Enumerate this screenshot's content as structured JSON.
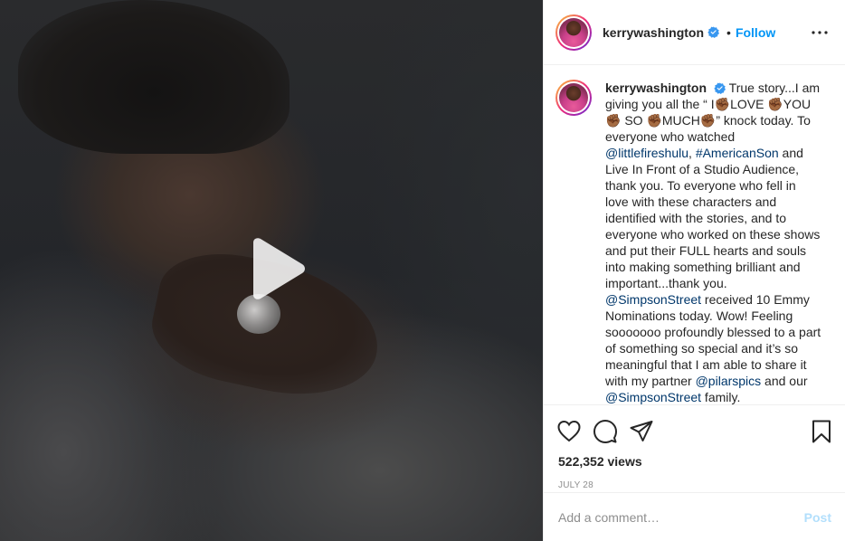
{
  "media": {
    "play_icon": "play-icon"
  },
  "header": {
    "username": "kerrywashington",
    "verified_icon": "verified-badge-icon",
    "separator": "•",
    "follow_label": "Follow",
    "more_icon": "more-horizontal-icon"
  },
  "caption": {
    "username": "kerrywashington",
    "parts": {
      "t1": "True story...I am giving you all the “ I",
      "e1": "✊🏾",
      "t2": "LOVE ",
      "e2": "✊🏾",
      "t3": "YOU",
      "e3": "✊🏾",
      "t4": " SO ",
      "e4": "✊🏾",
      "t5": "MUCH",
      "e5": "✊🏾",
      "t6": "” knock today. To everyone who watched ",
      "m1": "@littlefireshulu",
      "t7": ", ",
      "m2": "#AmericanSon",
      "t8": " and Live In Front of a Studio Audience, thank you. To everyone who fell in love with these characters and identified with the stories, and to everyone who worked on these shows and put their FULL hearts and souls into making something brilliant and important...thank you. ",
      "m3": "@SimpsonStreet",
      "t9": " received 10 Emmy Nominations today. Wow! Feeling sooooooo profoundly blessed to a part of something so special and it’s so meaningful that I am able to share it with my partner ",
      "m4": "@pilarspics",
      "t10": " and our ",
      "m5": "@SimpsonStreet",
      "t11": " family."
    }
  },
  "actions": {
    "like_icon": "heart-icon",
    "comment_icon": "comment-icon",
    "share_icon": "share-icon",
    "save_icon": "bookmark-icon"
  },
  "stats": {
    "views": "522,352 views",
    "date": "JULY 28"
  },
  "comment_box": {
    "placeholder": "Add a comment…",
    "post_label": "Post"
  },
  "colors": {
    "accent": "#0095f6",
    "mention": "#00376b",
    "muted": "#8e8e8e",
    "post_disabled": "#b2dffc"
  }
}
